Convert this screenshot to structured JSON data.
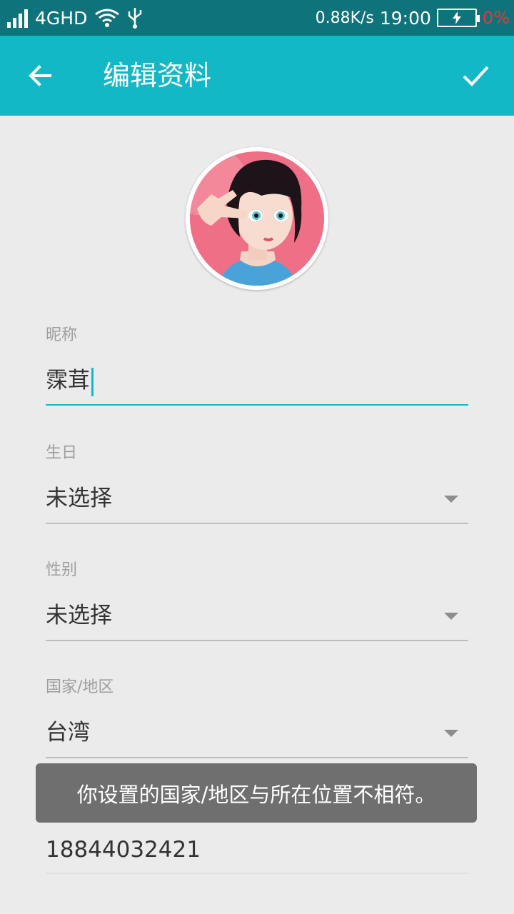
{
  "status_bar": {
    "network": "4GHD",
    "speed": "0.88K/s",
    "time": "19:00",
    "battery_percent": "0%",
    "icons": [
      "signal-icon",
      "wifi-icon",
      "usb-icon",
      "battery-charging-icon"
    ]
  },
  "app_bar": {
    "title": "编辑资料",
    "back_icon": "arrow-left-icon",
    "confirm_icon": "check-icon"
  },
  "profile": {
    "nickname_label": "昵称",
    "nickname_value": "霂茸",
    "birthday_label": "生日",
    "birthday_value": "未选择",
    "gender_label": "性别",
    "gender_value": "未选择",
    "region_label": "国家/地区",
    "region_value": "台湾",
    "phone_value": "18844032421"
  },
  "toast": {
    "message": "你设置的国家/地区与所在位置不相符。"
  },
  "colors": {
    "status_bar": "#0f737b",
    "app_bar": "#13b8c7",
    "accent": "#13b8c7",
    "background": "#ebebeb",
    "battery_low": "#e53935"
  }
}
